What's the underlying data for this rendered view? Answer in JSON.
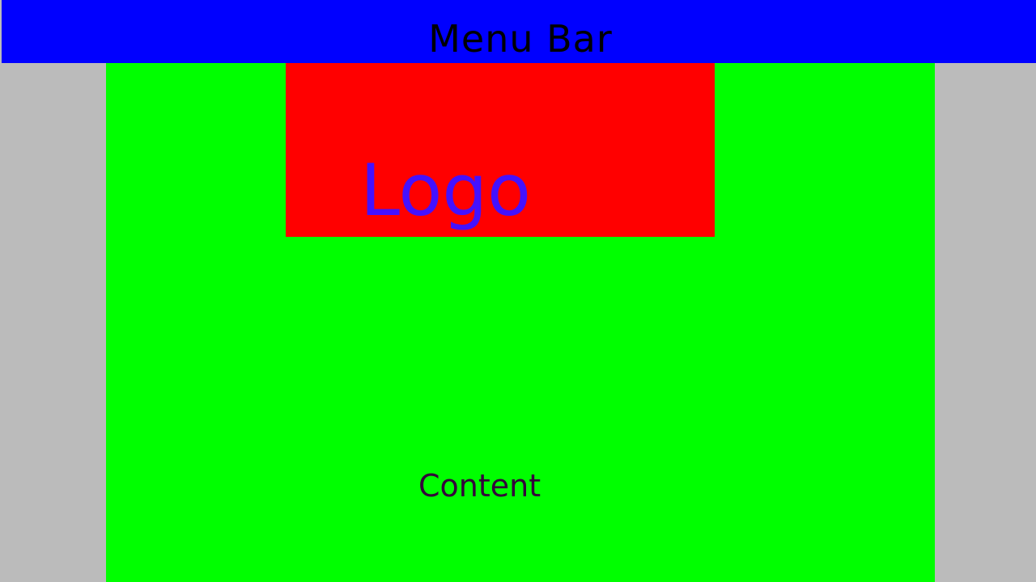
{
  "menu_bar": {
    "label": "Menu Bar",
    "color": "#0000ff"
  },
  "logo": {
    "label": "Logo",
    "background": "#ff0000",
    "text_color": "#4411ff"
  },
  "content": {
    "label": "Content",
    "background": "#00ff00"
  },
  "page": {
    "background": "#bbbbbb"
  }
}
